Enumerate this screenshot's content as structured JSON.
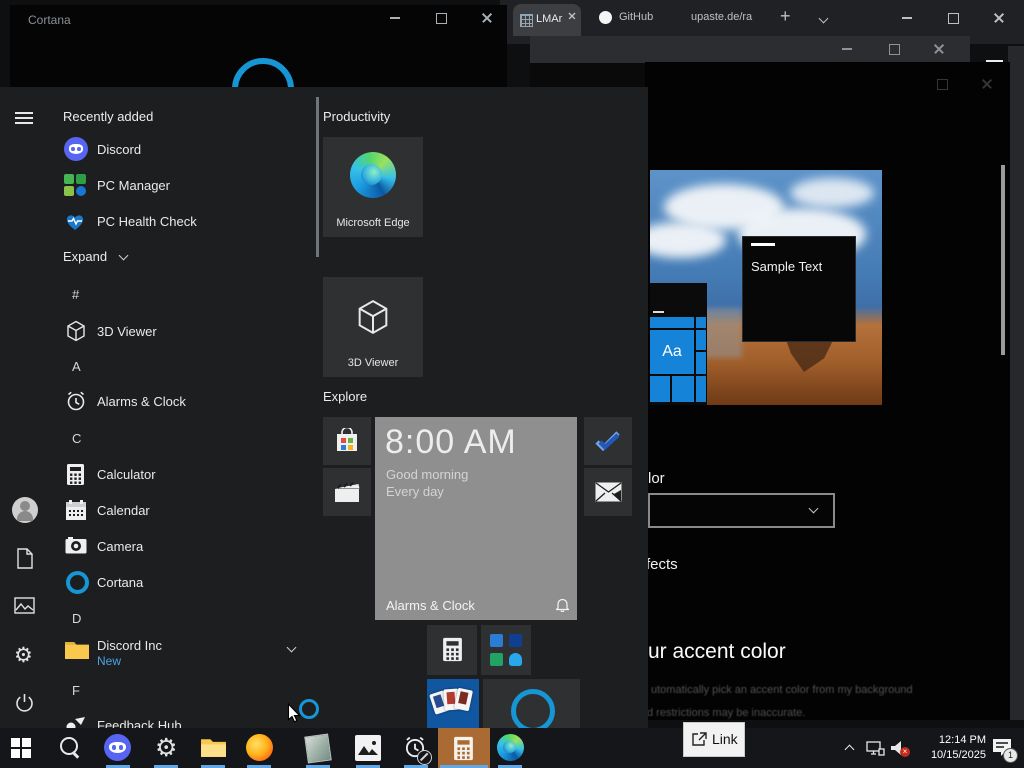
{
  "colors": {
    "accent": "#0078d7",
    "cortana_blue": "#1796d6",
    "discord_brand": "#5865f2",
    "calculator_highlight": "#a96a33",
    "new_badge_text": "#4ba3e3"
  },
  "cortana": {
    "title": "Cortana"
  },
  "browser": {
    "tabs": [
      {
        "label": "LMAr"
      },
      {
        "label": "GitHub"
      },
      {
        "label": "upaste.de/ra"
      }
    ],
    "new_tab": "+"
  },
  "start_menu": {
    "recent": {
      "header": "Recently added",
      "items": [
        {
          "label": "Discord"
        },
        {
          "label": "PC Manager"
        },
        {
          "label": "PC Health Check"
        }
      ],
      "expand_label": "Expand"
    },
    "list": [
      {
        "label": "#"
      },
      {
        "label": "3D Viewer"
      },
      {
        "label": "A"
      },
      {
        "label": "Alarms & Clock"
      },
      {
        "label": "C"
      },
      {
        "label": "Calculator"
      },
      {
        "label": "Calendar"
      },
      {
        "label": "Camera"
      },
      {
        "label": "Cortana"
      },
      {
        "label": "D"
      },
      {
        "label": "Discord Inc",
        "badge": "New"
      },
      {
        "label": "F"
      },
      {
        "label": "Feedback Hub"
      }
    ],
    "groups": {
      "productivity": "Productivity",
      "explore": "Explore"
    },
    "tiles": {
      "edge_label": "Microsoft Edge",
      "viewer_label": "3D Viewer",
      "live": {
        "time": "8:00 AM",
        "greeting": "Good morning",
        "frequency": "Every day",
        "app": "Alarms & Clock"
      }
    }
  },
  "settings": {
    "color_label": "lor",
    "effects_label": "fects",
    "accent_heading": "ur accent color",
    "auto_accent_line": "utomatically pick an accent color from my background",
    "footnote": "d restrictions may be inaccurate.",
    "preview": {
      "sample_text": "Sample Text",
      "tile_text": "Aa"
    }
  },
  "link_popup": {
    "label": "Link"
  },
  "tray": {
    "time": "12:14 PM",
    "date": "10/15/2025",
    "badge": "1"
  }
}
